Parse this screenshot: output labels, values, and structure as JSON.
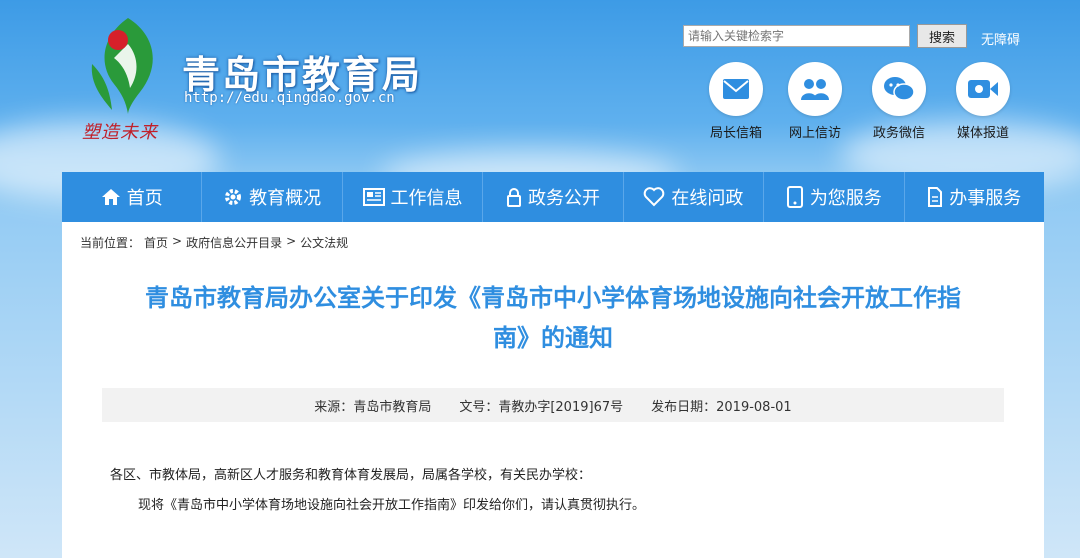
{
  "header": {
    "site_title": "青岛市教育局",
    "site_url": "http://edu.qingdao.gov.cn",
    "seal_text": "塑造未来",
    "search_placeholder": "请输入关键检索字",
    "search_button": "搜索",
    "accessible_label": "无障碍",
    "quick_links": [
      {
        "label": "局长信箱",
        "icon": "mail-icon"
      },
      {
        "label": "网上信访",
        "icon": "people-icon"
      },
      {
        "label": "政务微信",
        "icon": "wechat-icon"
      },
      {
        "label": "媒体报道",
        "icon": "video-icon"
      }
    ]
  },
  "nav": {
    "items": [
      {
        "label": "首页",
        "icon": "home-icon"
      },
      {
        "label": "教育概况",
        "icon": "gear-icon"
      },
      {
        "label": "工作信息",
        "icon": "newspaper-icon"
      },
      {
        "label": "政务公开",
        "icon": "lock-icon"
      },
      {
        "label": "在线问政",
        "icon": "heart-icon"
      },
      {
        "label": "为您服务",
        "icon": "phone-icon"
      },
      {
        "label": "办事服务",
        "icon": "document-icon"
      }
    ]
  },
  "breadcrumb": {
    "prefix": "当前位置：",
    "items": [
      "首页",
      "政府信息公开目录",
      "公文法规"
    ],
    "separator": ">"
  },
  "article": {
    "title_line1": "青岛市教育局办公室关于印发《青岛市中小学体育场地设施向社会开放工作指",
    "title_line2": "南》的通知",
    "meta": {
      "source_label": "来源：",
      "source": "青岛市教育局",
      "doc_no_label": "文号：",
      "doc_no": "青教办字[2019]67号",
      "date_label": "发布日期：",
      "date": "2019-08-01"
    },
    "para1": "各区、市教体局，高新区人才服务和教育体育发展局，局属各学校，有关民办学校：",
    "para2": "现将《青岛市中小学体育场地设施向社会开放工作指南》印发给你们，请认真贯彻执行。"
  },
  "colors": {
    "nav_bg": "#2f8ee0",
    "title_color": "#2f8ee0",
    "seal_red": "#c0202a",
    "logo_green": "#2a9a3a"
  }
}
